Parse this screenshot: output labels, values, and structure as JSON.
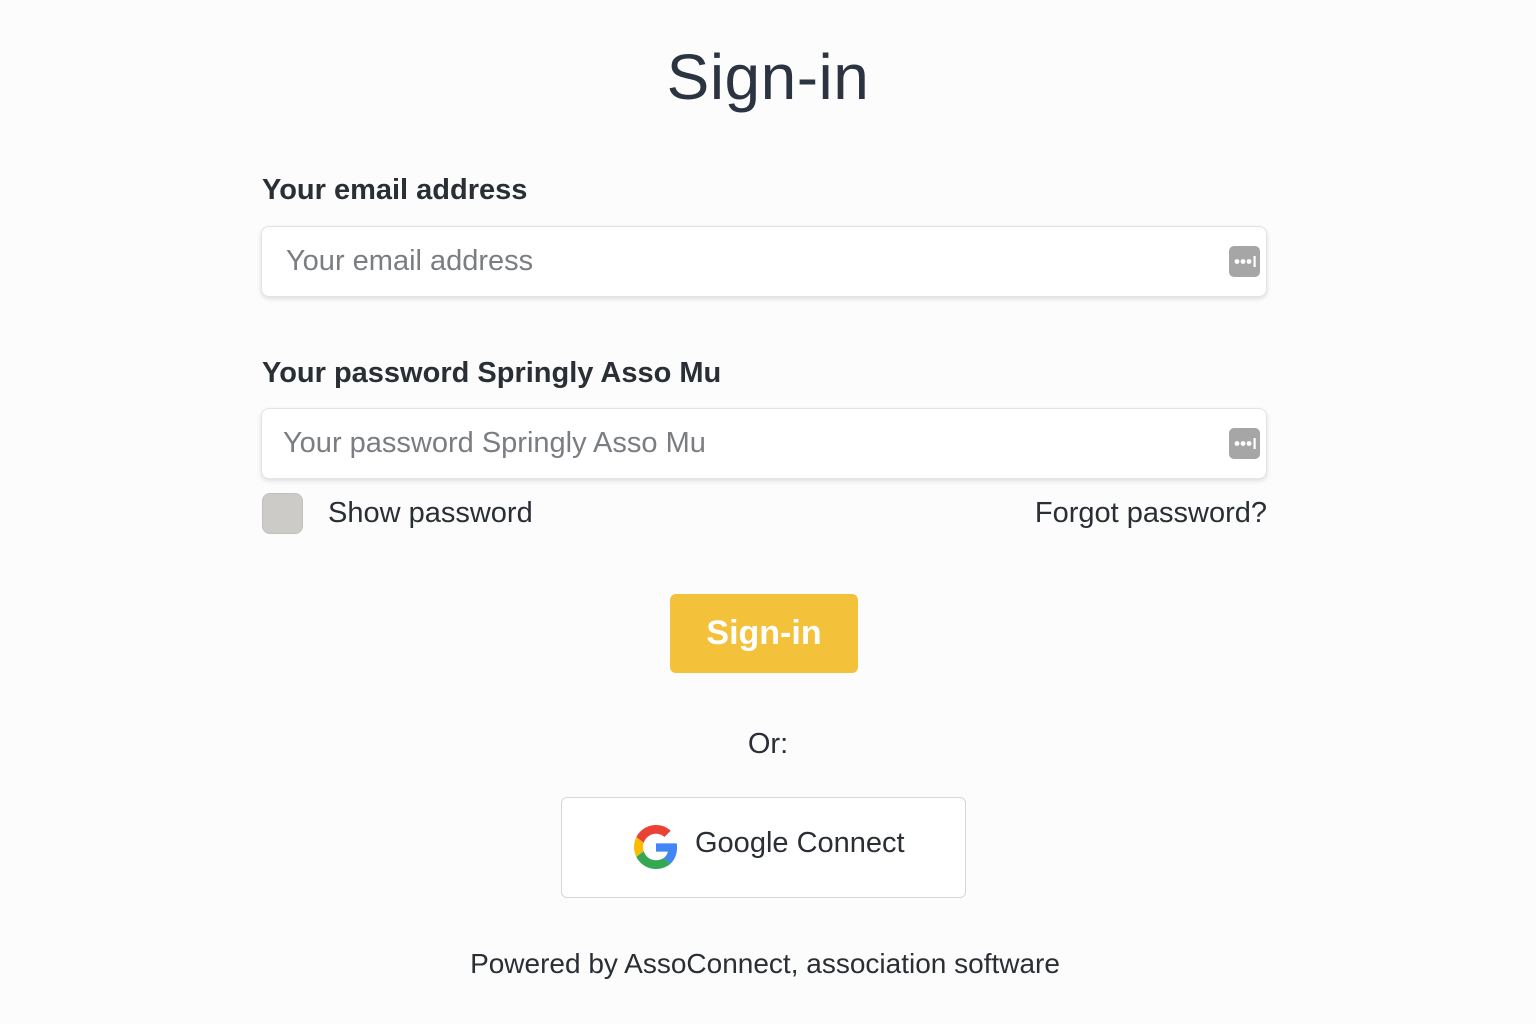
{
  "page": {
    "title": "Sign-in"
  },
  "email": {
    "label": "Your email address",
    "placeholder": "Your email address",
    "value": "",
    "icon": "password-manager-icon"
  },
  "password": {
    "label": "Your password Springly Asso Mu",
    "placeholder": "Your password Springly Asso Mu",
    "value": "",
    "icon": "password-manager-icon"
  },
  "options": {
    "show_password_label": "Show password",
    "show_password_checked": false,
    "forgot_password_label": "Forgot password?"
  },
  "actions": {
    "signin_label": "Sign-in",
    "or_label": "Or:",
    "google_label": "Google Connect",
    "google_icon": "google-icon"
  },
  "footer": {
    "text": "Powered by AssoConnect, association software"
  },
  "colors": {
    "primary_button": "#f3c13a",
    "text": "#2a2e35",
    "title": "#2c3442",
    "checkbox": "#cdcbc8"
  }
}
